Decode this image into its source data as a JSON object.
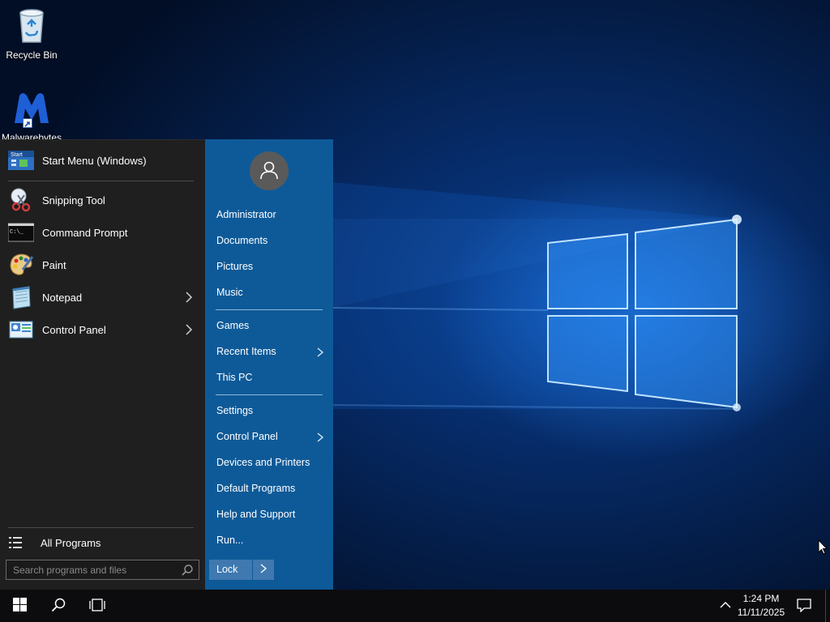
{
  "desktop": {
    "icons": [
      {
        "label": "Recycle Bin",
        "icon": "recycle-bin-icon"
      },
      {
        "label": "Malwarebytes",
        "icon": "malwarebytes-icon"
      }
    ]
  },
  "start_menu": {
    "pinned_header": {
      "label": "Start Menu (Windows)",
      "icon": "start-menu-icon"
    },
    "programs": [
      {
        "label": "Snipping Tool",
        "icon": "snipping-tool-icon",
        "has_submenu": false
      },
      {
        "label": "Command Prompt",
        "icon": "command-prompt-icon",
        "has_submenu": false
      },
      {
        "label": "Paint",
        "icon": "paint-icon",
        "has_submenu": false
      },
      {
        "label": "Notepad",
        "icon": "notepad-icon",
        "has_submenu": true
      },
      {
        "label": "Control Panel",
        "icon": "control-panel-icon",
        "has_submenu": true
      }
    ],
    "all_programs_label": "All Programs",
    "search": {
      "placeholder": "Search programs and files",
      "value": ""
    },
    "right_panel": {
      "user": "Administrator",
      "group1": [
        "Documents",
        "Pictures",
        "Music"
      ],
      "group2": [
        {
          "label": "Games",
          "has_submenu": false
        },
        {
          "label": "Recent Items",
          "has_submenu": true
        },
        {
          "label": "This PC",
          "has_submenu": false
        }
      ],
      "group3": [
        {
          "label": "Settings",
          "has_submenu": false
        },
        {
          "label": "Control Panel",
          "has_submenu": true
        },
        {
          "label": "Devices and Printers",
          "has_submenu": false
        },
        {
          "label": "Default Programs",
          "has_submenu": false
        },
        {
          "label": "Help and Support",
          "has_submenu": false
        },
        {
          "label": "Run...",
          "has_submenu": false
        }
      ],
      "lock_label": "Lock"
    },
    "colors": {
      "left_bg": "#1f1f1f",
      "right_bg": "#0e5a98",
      "lock_bg": "#3f79b0"
    }
  },
  "taskbar": {
    "buttons": [
      "start-button",
      "search-button",
      "task-view-button"
    ],
    "tray": {
      "time": "1:24 PM",
      "date": "11/11/2025"
    }
  }
}
